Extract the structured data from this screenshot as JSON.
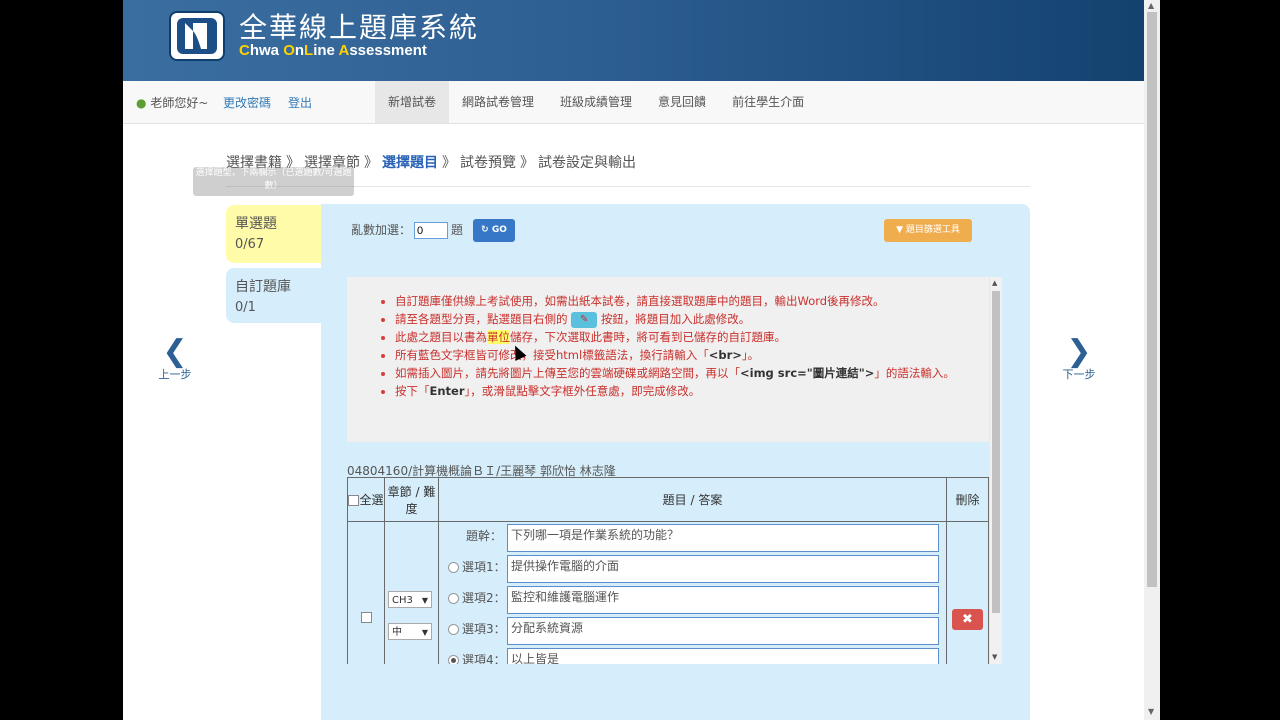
{
  "header": {
    "title": "全華線上題庫系統",
    "subtitle_parts": [
      "C",
      "hwa ",
      "O",
      "n",
      "L",
      "ine ",
      "A",
      "ssessment"
    ]
  },
  "nav": {
    "greeting": "老師您好~",
    "change_password": "更改密碼",
    "logout": "登出",
    "menu": [
      "新增試卷",
      "網路試卷管理",
      "班級成績管理",
      "意見回饋",
      "前往學生介面"
    ]
  },
  "steps": {
    "items": [
      "選擇書籍",
      "選擇章節",
      "選擇題目",
      "試卷預覽",
      "試卷設定與輸出"
    ],
    "separator": "》"
  },
  "tooltip": "選擇題型，下兩欄示（已選題數/可選題數）",
  "tabs": [
    {
      "label": "單選題",
      "count": "0/67"
    },
    {
      "label": "自訂題庫",
      "count": "0/1"
    }
  ],
  "toolbar": {
    "random_label": "亂數加選：",
    "random_value": "0",
    "random_unit": "題",
    "go_label": "GO",
    "filter_label": "題目篩選工具"
  },
  "notes": [
    "自訂題庫僅供線上考試使用，如需出紙本試卷，請直接選取題庫中的題目，輸出Word後再修改。",
    "請至各題型分頁，點選題目右側的",
    "按鈕，將題目加入此處修改。",
    "此處之題目以書為",
    "單位",
    "儲存，下次選取此書時，將可看到已儲存的自訂題庫。",
    "所有藍色文字框皆可修改，接受html標籤語法，換行請輸入「",
    "<br>",
    "」。",
    "如需插入圖片，請先將圖片上傳至您的雲端硬碟或網路空間，再以「",
    "<img src=\"圖片連結\">",
    "」的語法輸入。",
    "按下「",
    "Enter",
    "」，或滑鼠點擊文字框外任意處，即完成修改。"
  ],
  "book": "04804160/計算機概論ＢＩ/王麗琴 郭欣怡 林志隆",
  "table": {
    "headers": {
      "select_all": "全選",
      "chapter": "章節 / 難度",
      "question": "題目 / 答案",
      "delete": "刪除"
    },
    "row": {
      "chapter": "CH3",
      "difficulty": "中",
      "stem_label": "題幹：",
      "stem": "下列哪一項是作業系統的功能？",
      "options": [
        {
          "label": "選項1：",
          "text": "提供操作電腦的介面",
          "selected": false
        },
        {
          "label": "選項2：",
          "text": "監控和維護電腦運作",
          "selected": false
        },
        {
          "label": "選項3：",
          "text": "分配系統資源",
          "selected": false
        },
        {
          "label": "選項4：",
          "text": "以上皆是",
          "selected": true
        }
      ]
    }
  },
  "pager": {
    "prev": "上一步",
    "next": "下一步"
  },
  "colors": {
    "banner": "#2e5f93",
    "panel": "#d6eefb",
    "highlight_tab": "#fffba8",
    "accent": "#3678c7",
    "warning": "#f0ad4e",
    "danger": "#d9534f"
  }
}
